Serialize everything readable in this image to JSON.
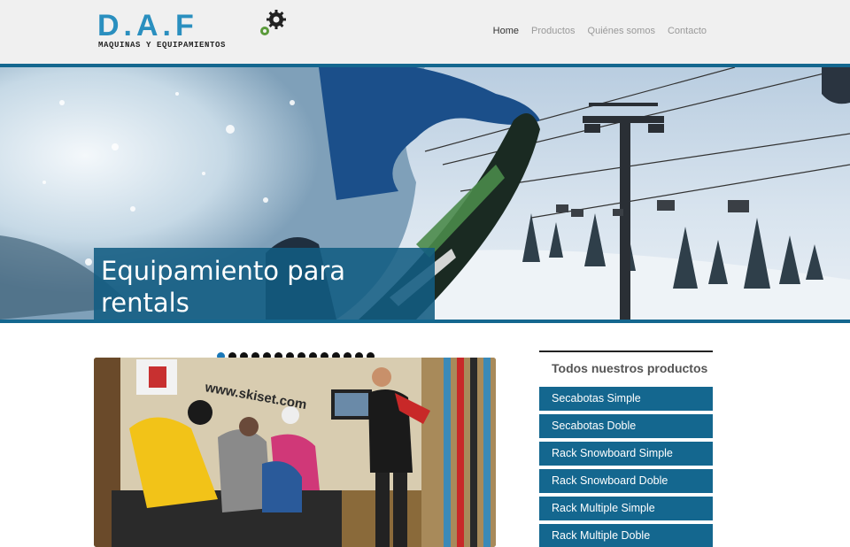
{
  "header": {
    "logo_text": "D.A.F",
    "logo_tagline": "MAQUINAS Y EQUIPAMIENTOS"
  },
  "nav": {
    "items": [
      {
        "label": "Home",
        "active": true
      },
      {
        "label": "Productos",
        "active": false
      },
      {
        "label": "Quiénes somos",
        "active": false
      },
      {
        "label": "Contacto",
        "active": false
      }
    ]
  },
  "hero": {
    "caption": "Equipamiento para rentals"
  },
  "slider": {
    "slide_count": 14,
    "active_index": 0,
    "sign_text": "www.skiset.com"
  },
  "products": {
    "title": "Todos nuestros productos",
    "items": [
      "Secabotas Simple",
      "Secabotas Doble",
      "Rack Snowboard Simple",
      "Rack Snowboard Doble",
      "Rack Multiple Simple",
      "Rack Multiple Doble"
    ]
  },
  "colors": {
    "accent": "#14678f",
    "logo_blue": "#2a8fbf",
    "header_bg": "#f0f0f0"
  }
}
